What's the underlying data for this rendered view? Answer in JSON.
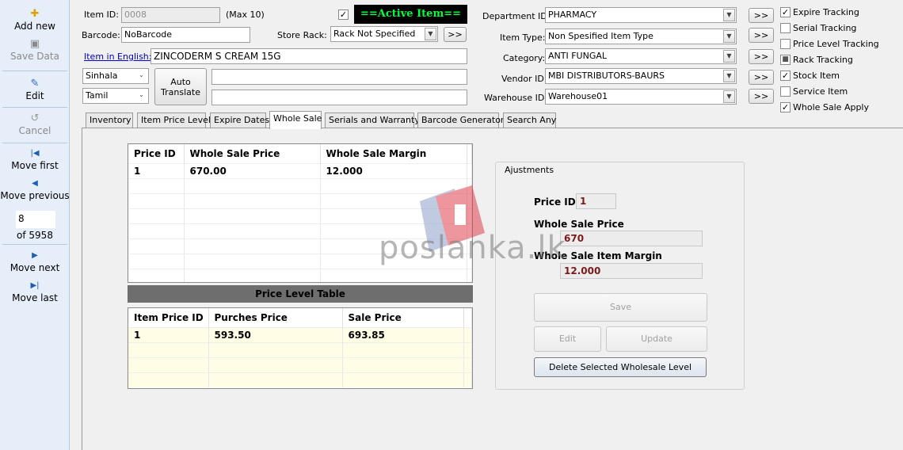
{
  "sidebar": {
    "add_new": "Add new",
    "save_data": "Save Data",
    "edit": "Edit",
    "cancel": "Cancel",
    "move_first": "Move first",
    "move_previous": "Move previous",
    "record_number": "8",
    "record_total": "of 5958",
    "move_next": "Move next",
    "move_last": "Move last"
  },
  "form": {
    "item_id_label": "Item ID:",
    "item_id_value": "0008",
    "item_id_max": "(Max 10)",
    "active_item": "==Active Item==",
    "barcode_label": "Barcode:",
    "barcode_value": "NoBarcode",
    "store_rack_label": "Store Rack:",
    "store_rack_value": "Rack Not Specified",
    "item_english_label": "Item in English:",
    "item_english_value": "ZINCODERM S CREAM 15G",
    "lang1": "Sinhala",
    "lang2": "Tamil",
    "auto_translate": "Auto Translate",
    "lang1_value": "",
    "lang2_value": "",
    "more_button": ">>"
  },
  "right_fields": [
    {
      "label": "Department ID:",
      "value": "PHARMACY"
    },
    {
      "label": "Item Type:",
      "value": "Non Spesified Item Type"
    },
    {
      "label": "Category:",
      "value": "ANTI FUNGAL"
    },
    {
      "label": "Vendor ID:",
      "value": "MBI DISTRIBUTORS-BAURS"
    },
    {
      "label": "Warehouse ID:",
      "value": "Warehouse01"
    }
  ],
  "options": [
    {
      "label": "Expire Tracking",
      "state": "checked"
    },
    {
      "label": "Serial Tracking",
      "state": "unchecked"
    },
    {
      "label": "Price Level Tracking",
      "state": "unchecked"
    },
    {
      "label": "Rack Tracking",
      "state": "indeterminate"
    },
    {
      "label": "Stock Item",
      "state": "checked"
    },
    {
      "label": "Service Item",
      "state": "unchecked"
    },
    {
      "label": "Whole Sale Apply",
      "state": "checked"
    }
  ],
  "tabs": [
    "Inventory",
    "Item Price Level",
    "Expire Dates",
    "Whole Sale",
    "Serials and Warranty",
    "Barcode Generator",
    "Search Any"
  ],
  "active_tab": "Whole Sale",
  "wholesale_table": {
    "headers": [
      "Price ID",
      "Whole Sale Price",
      "Whole Sale Margin"
    ],
    "rows": [
      [
        "1",
        "670.00",
        "12.000"
      ]
    ]
  },
  "price_level_title": "Price Level Table",
  "price_level_table": {
    "headers": [
      "Item Price ID",
      "Purches Price",
      "Sale Price"
    ],
    "rows": [
      [
        "1",
        "593.50",
        "693.85"
      ]
    ]
  },
  "adjustments": {
    "title": "Ajustments",
    "price_id_label": "Price ID",
    "price_id_value": "1",
    "wholesale_price_label": "Whole Sale Price",
    "wholesale_price_value": "670",
    "margin_label": "Whole Sale Item Margin",
    "margin_value": "12.000",
    "save": "Save",
    "edit": "Edit",
    "update": "Update",
    "delete": "Delete Selected Wholesale Level"
  },
  "watermark": "poslanka.lk",
  "colors": {
    "active_item_bg": "#000000",
    "active_item_text": "#00ff3c",
    "sidebar_bg": "#e6eef9"
  }
}
